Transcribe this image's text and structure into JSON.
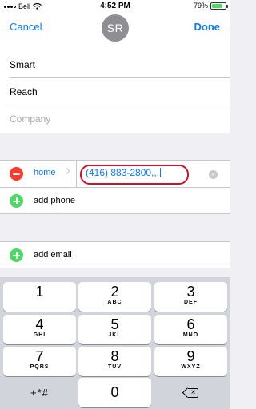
{
  "status_bar": {
    "carrier": "Bell",
    "time": "4:52 PM",
    "battery_percent": "79%",
    "battery_level": 0.79
  },
  "navbar": {
    "cancel_label": "Cancel",
    "avatar_initials": "SR",
    "done_label": "Done"
  },
  "name_fields": {
    "first_name": "Smart",
    "last_name": "Reach",
    "company_placeholder": "Company"
  },
  "phone": {
    "label": "home",
    "value": "(416) 883-2800,,,",
    "add_label": "add phone"
  },
  "email": {
    "add_label": "add email"
  },
  "keypad": {
    "keys": [
      {
        "num": "1",
        "letters": ""
      },
      {
        "num": "2",
        "letters": "ABC"
      },
      {
        "num": "3",
        "letters": "DEF"
      },
      {
        "num": "4",
        "letters": "GHI"
      },
      {
        "num": "5",
        "letters": "JKL"
      },
      {
        "num": "6",
        "letters": "MNO"
      },
      {
        "num": "7",
        "letters": "PQRS"
      },
      {
        "num": "8",
        "letters": "TUV"
      },
      {
        "num": "9",
        "letters": "WXYZ"
      }
    ],
    "symbols": "+*#",
    "zero": "0"
  },
  "icons": [
    "wifi-icon",
    "battery-icon",
    "charging-icon",
    "minus-circle-icon",
    "chevron-right-icon",
    "clear-icon",
    "plus-circle-icon",
    "backspace-icon"
  ],
  "colors": {
    "accent": "#0a7aff",
    "delete": "#ff3b30",
    "add": "#4cd964",
    "annotation": "#d0112b"
  }
}
